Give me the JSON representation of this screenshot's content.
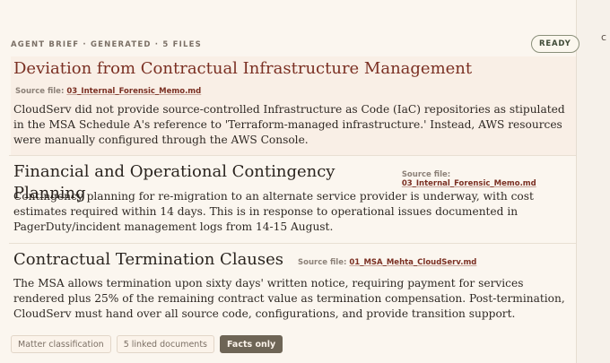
{
  "header": {
    "eyebrow": "AGENT BRIEF · GENERATED · 5 FILES",
    "status_badge": "READY"
  },
  "edge_icon": "c",
  "sections": [
    {
      "title": "Deviation from Contractual Infrastructure Management",
      "source_label": "Source file:",
      "source_file": "03_Internal_Forensic_Memo.md",
      "body": "CloudServ did not provide source-controlled Infrastructure as Code (IaC) repositories as stipulated in the MSA Schedule A's reference to 'Terraform-managed infrastructure.' Instead, AWS resources were manually configured through the AWS Console."
    },
    {
      "title": "Financial and Operational Contingency Planning",
      "source_label": "Source file:",
      "source_file": "03_Internal_Forensic_Memo.md",
      "body": "Contingency planning for re-migration to an alternate service provider is underway, with cost estimates required within 14 days. This is in response to operational issues documented in PagerDuty/incident management logs from 14-15 August."
    },
    {
      "title": "Contractual Termination Clauses",
      "source_label": "Source file:",
      "source_file": "01_MSA_Mehta_CloudServ.md",
      "body": "The MSA allows termination upon sixty days' written notice, requiring payment for services rendered plus 25% of the remaining contract value as termination compensation. Post-termination, CloudServ must hand over all source code, configurations, and provide transition support."
    }
  ],
  "chips": [
    {
      "label": "Matter classification",
      "active": false
    },
    {
      "label": "5 linked documents",
      "active": false
    },
    {
      "label": "Facts only",
      "active": true
    }
  ]
}
